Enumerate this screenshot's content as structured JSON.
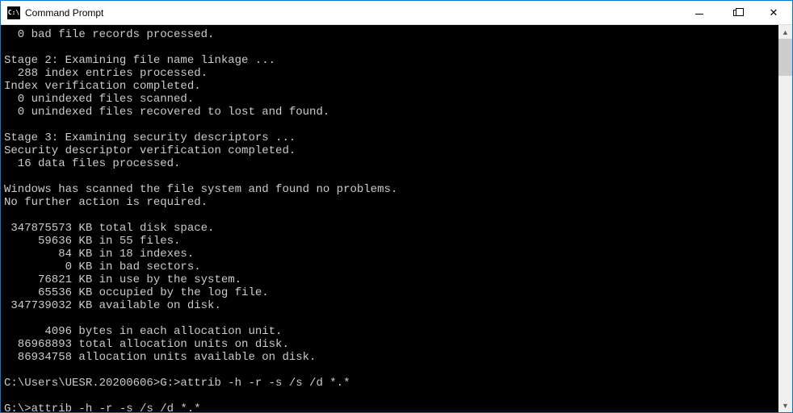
{
  "window": {
    "title": "Command Prompt",
    "icon_label": "C:\\"
  },
  "terminal": {
    "lines": [
      "  0 bad file records processed.",
      "",
      "Stage 2: Examining file name linkage ...",
      "  288 index entries processed.",
      "Index verification completed.",
      "  0 unindexed files scanned.",
      "  0 unindexed files recovered to lost and found.",
      "",
      "Stage 3: Examining security descriptors ...",
      "Security descriptor verification completed.",
      "  16 data files processed.",
      "",
      "Windows has scanned the file system and found no problems.",
      "No further action is required.",
      "",
      " 347875573 KB total disk space.",
      "     59636 KB in 55 files.",
      "        84 KB in 18 indexes.",
      "         0 KB in bad sectors.",
      "     76821 KB in use by the system.",
      "     65536 KB occupied by the log file.",
      " 347739032 KB available on disk.",
      "",
      "      4096 bytes in each allocation unit.",
      "  86968893 total allocation units on disk.",
      "  86934758 allocation units available on disk.",
      "",
      "C:\\Users\\UESR.20200606>G:>attrib -h -r -s /s /d *.*",
      "",
      "G:\\>attrib -h -r -s /s /d *.*"
    ]
  }
}
